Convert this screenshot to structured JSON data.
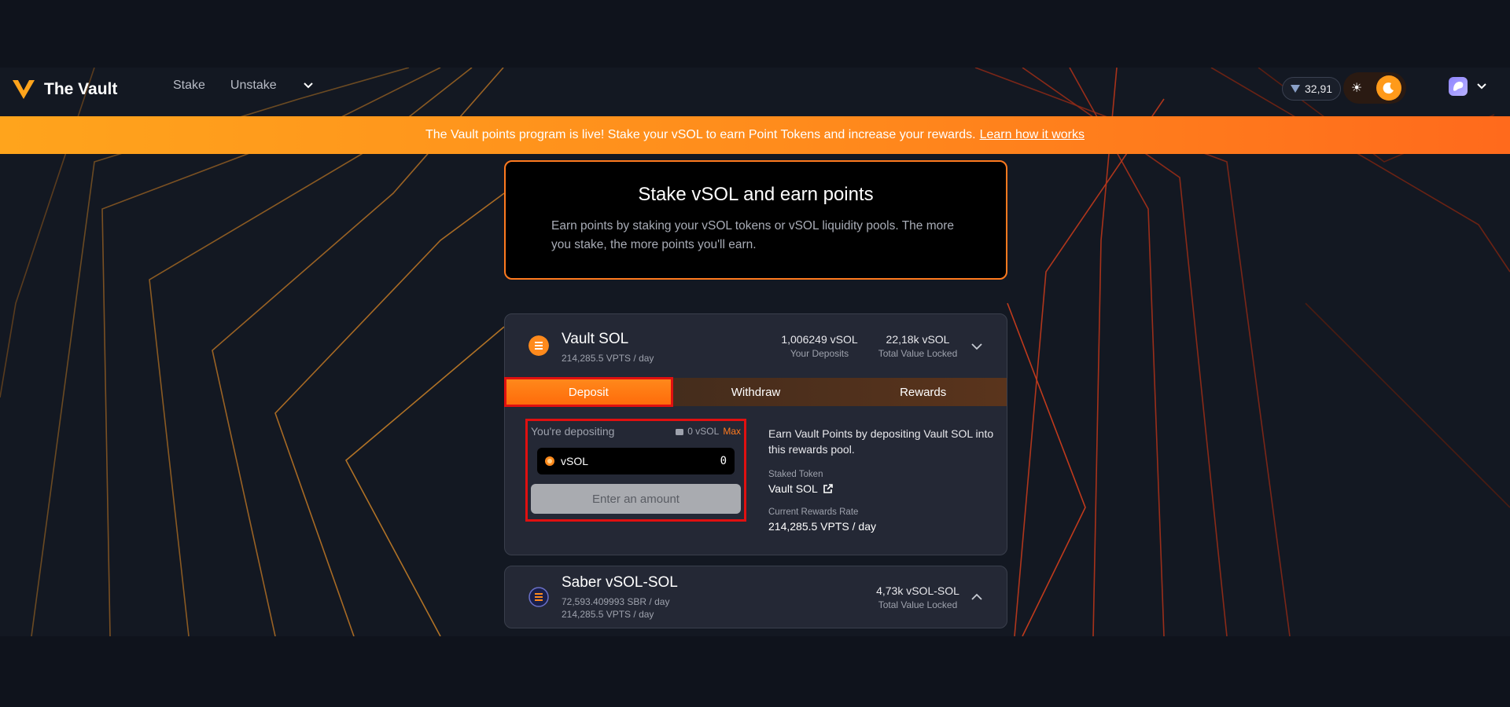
{
  "app": {
    "title": "The Vault"
  },
  "nav": {
    "items": [
      "Stake",
      "Unstake"
    ]
  },
  "header": {
    "balance": "32,91"
  },
  "banner": {
    "text": "The Vault points program is live! Stake your vSOL to earn Point Tokens and increase your rewards.",
    "link": "Learn how it works"
  },
  "hero": {
    "title": "Stake vSOL and earn points",
    "subtitle": "Earn points by staking your vSOL tokens or vSOL liquidity pools. The more you stake, the more points you'll earn."
  },
  "pools": [
    {
      "name": "Vault SOL",
      "rates": [
        "214,285.5 VPTS / day"
      ],
      "deposits_value": "1,006249 vSOL",
      "deposits_label": "Your Deposits",
      "tvl_value": "22,18k vSOL",
      "tvl_label": "Total Value Locked",
      "tabs": [
        "Deposit",
        "Withdraw",
        "Rewards"
      ],
      "active_tab": "Deposit",
      "deposit": {
        "label": "You're depositing",
        "balance": "0 vSOL",
        "max_label": "Max",
        "token": "vSOL",
        "amount": "0",
        "button_label": "Enter an amount"
      },
      "info": {
        "description": "Earn Vault Points by depositing Vault SOL into this rewards pool.",
        "staked_token_label": "Staked Token",
        "staked_token_value": "Vault SOL",
        "rewards_rate_label": "Current Rewards Rate",
        "rewards_rate_value": "214,285.5 VPTS / day"
      }
    },
    {
      "name": "Saber vSOL-SOL",
      "rates": [
        "72,593.409993 SBR / day",
        "214,285.5 VPTS / day"
      ],
      "tvl_value": "4,73k vSOL-SOL",
      "tvl_label": "Total Value Locked"
    }
  ],
  "icons": {
    "logo": "vault-logo-icon",
    "theme_light": "sun-icon",
    "theme_dark": "moon-icon",
    "wallet": "wallet-avatar-icon"
  },
  "colors": {
    "accent": "#ff7a1f",
    "banner_start": "#ffa41c",
    "banner_end": "#ff6a1c",
    "highlight": "#e01010"
  }
}
